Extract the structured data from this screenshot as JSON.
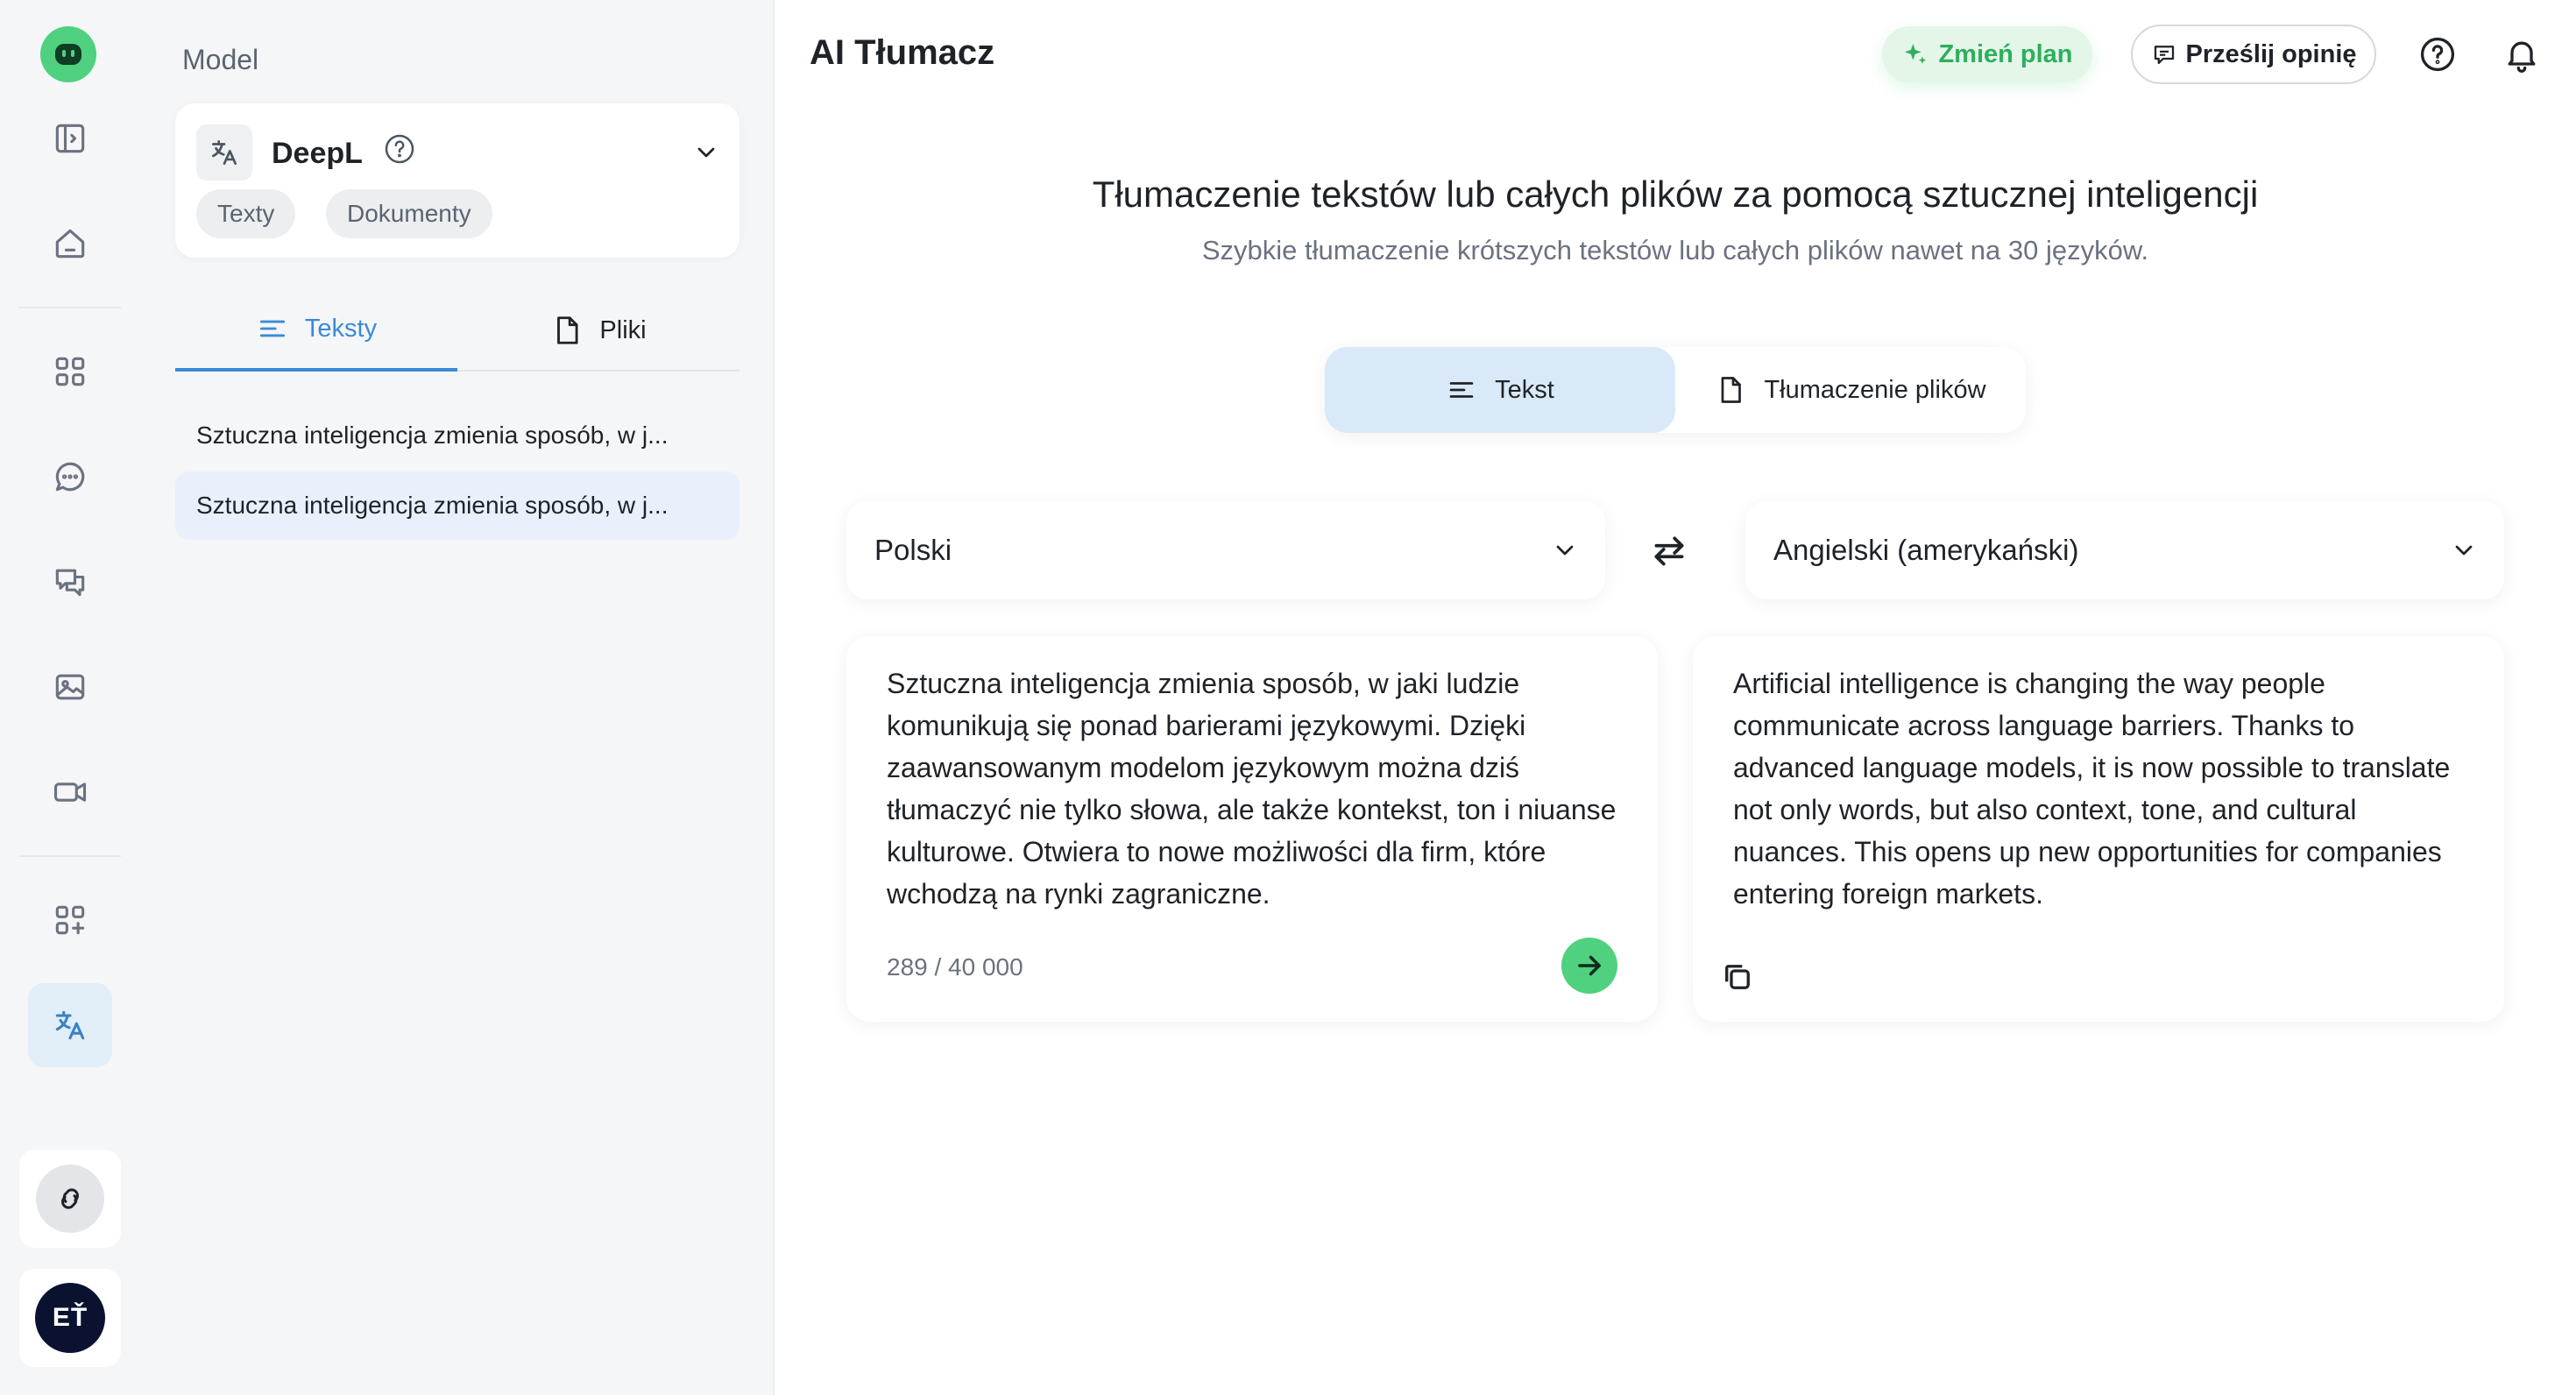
{
  "sidebar": {
    "icons": [
      "logo-icon",
      "sidebar-toggle-icon",
      "home-icon",
      "apps-grid-icon",
      "chat-icon",
      "chats-icon",
      "image-icon",
      "video-icon",
      "add-apps-icon",
      "translate-icon",
      "integrations-icon"
    ],
    "active": "translate-icon",
    "user_initials": "EŤ"
  },
  "panel": {
    "label": "Model",
    "model_name": "DeepL",
    "chips": [
      "Texty",
      "Dokumenty"
    ],
    "tabs": [
      {
        "label": "Teksty",
        "active": true
      },
      {
        "label": "Pliki",
        "active": false
      }
    ],
    "history": [
      {
        "text": "Sztuczna inteligencja zmienia sposób, w j...",
        "selected": false
      },
      {
        "text": "Sztuczna inteligencja zmienia sposób, w j...",
        "selected": true
      }
    ]
  },
  "header": {
    "title": "AI Tłumacz",
    "plan_button": "Zmień plan",
    "feedback_button": "Prześlij opinię"
  },
  "hero": {
    "title": "Tłumaczenie tekstów lub całych plików za pomocą sztucznej inteligencji",
    "subtitle": "Szybkie tłumaczenie krótszych tekstów lub całych plików nawet na 30 języków."
  },
  "modes": [
    {
      "label": "Tekst",
      "active": true
    },
    {
      "label": "Tłumaczenie plików",
      "active": false
    }
  ],
  "languages": {
    "source": "Polski",
    "target": "Angielski (amerykański)"
  },
  "source_text": "Sztuczna inteligencja zmienia sposób, w jaki ludzie komunikują się ponad barierami językowymi. Dzięki zaawansowanym modelom językowym można dziś tłumaczyć nie tylko słowa, ale także kontekst, ton i niuanse kulturowe. Otwiera to nowe możliwości dla firm, które wchodzą na rynki zagraniczne.",
  "target_text": "Artificial intelligence is changing the way people communicate across language barriers. Thanks to advanced language models, it is now possible to translate not only words, but also context, tone, and cultural nuances. This opens up new opportunities for companies entering foreign markets.",
  "counter": "289 / 40 000",
  "colors": {
    "accent_green": "#4fd17f",
    "accent_blue": "#3a8ad6",
    "active_tab_bg": "#d9e9f7"
  }
}
